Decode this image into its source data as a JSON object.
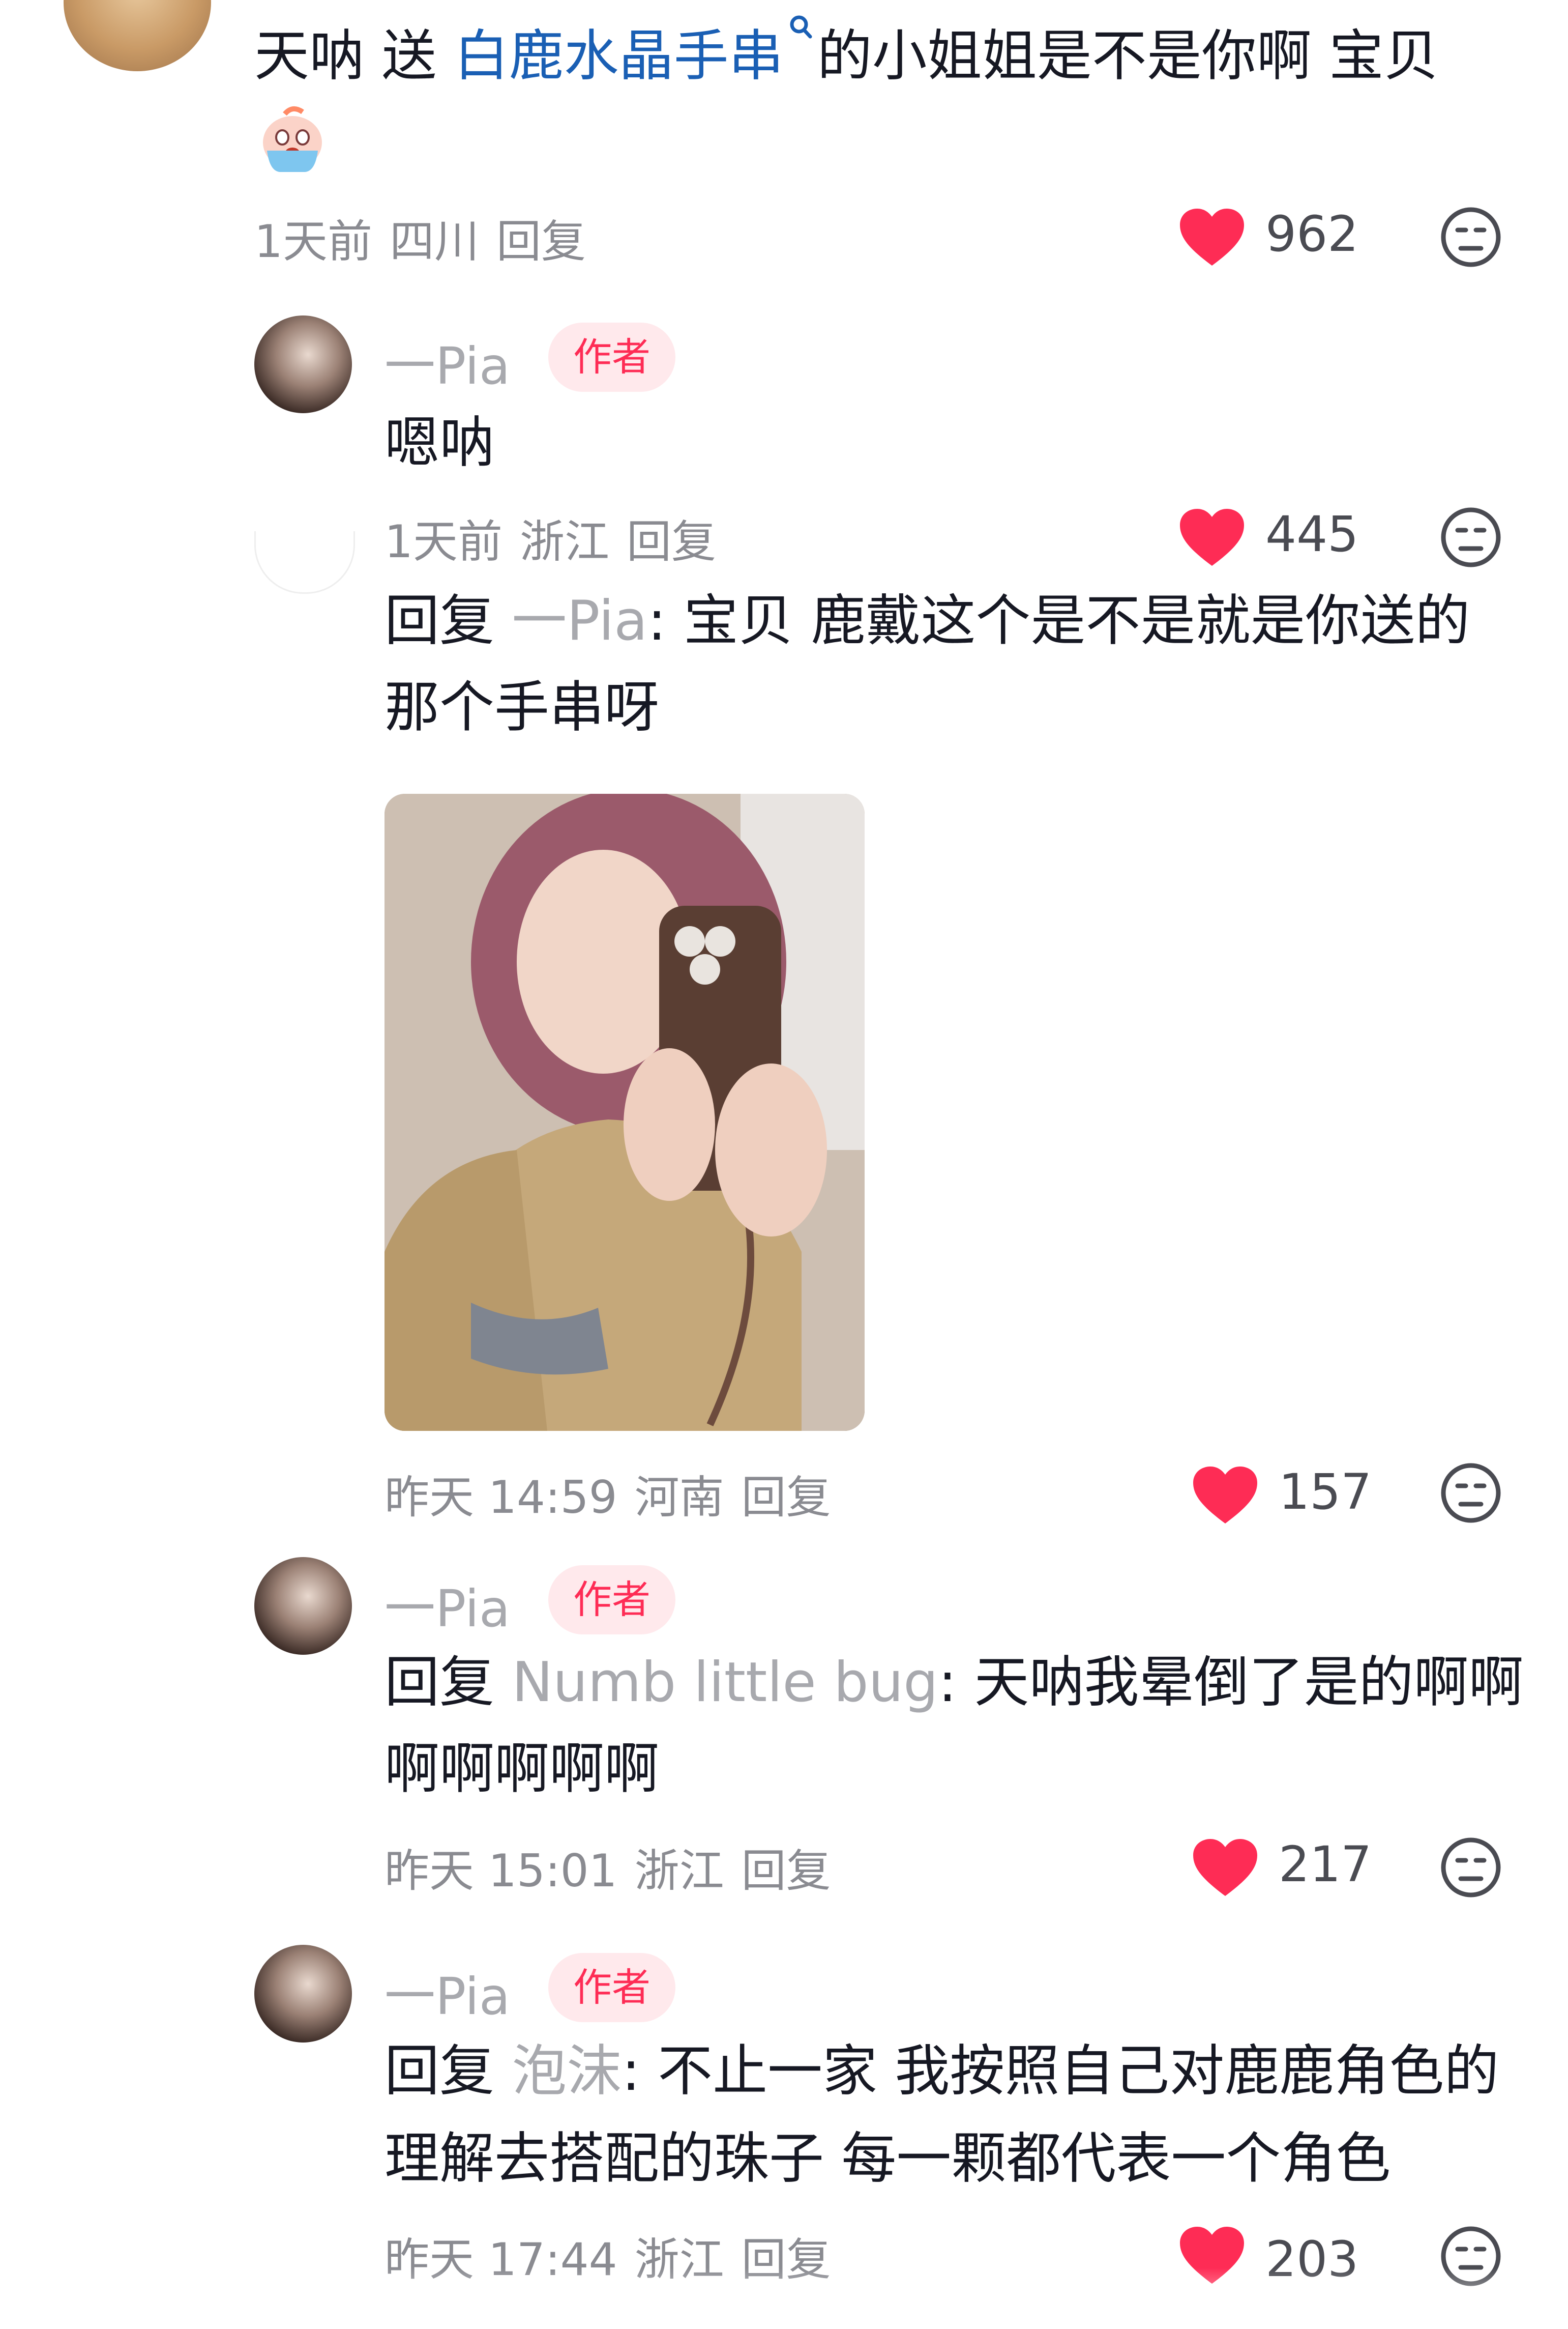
{
  "comments": [
    {
      "text_pre": "天呐 送 ",
      "link": "白鹿水晶手串",
      "text_post": "的小姐姐是不是你啊 宝贝",
      "emoji": "crying-face-emoji",
      "time": "1天前",
      "location": "四川",
      "reply_label": "回复",
      "likes": "962"
    }
  ],
  "replies": [
    {
      "name": "一Pia",
      "tag": "作者",
      "text": "嗯呐",
      "time": "1天前",
      "location": "浙江",
      "reply_label": "回复",
      "likes": "445"
    },
    {
      "reply_prefix": "回复",
      "reply_target": "一Pia",
      "line1": ": 宝贝 鹿戴这个是不是就是你送的",
      "line2": "那个手串呀",
      "time": "昨天 14:59",
      "location": "河南",
      "reply_label": "回复",
      "likes": "157"
    },
    {
      "name": "一Pia",
      "tag": "作者",
      "reply_prefix": "回复",
      "reply_target": "Numb little bug",
      "line1": ": 天呐我晕倒了是的啊啊",
      "line2": "啊啊啊啊啊",
      "time": "昨天 15:01",
      "location": "浙江",
      "reply_label": "回复",
      "likes": "217"
    },
    {
      "name": "一Pia",
      "tag": "作者",
      "reply_prefix": "回复",
      "reply_target": "泡沫",
      "line1": ": 不止一家 我按照自己对鹿鹿角色的",
      "line2": "理解去搭配的珠子 每一颗都代表一个角色",
      "time": "昨天 17:44",
      "location": "浙江",
      "reply_label": "回复",
      "likes": "203"
    }
  ],
  "icons": {
    "heart": "heart-icon",
    "emoji": "emoji-face-icon",
    "search": "search-icon"
  },
  "colors": {
    "heart": "#fe2c55",
    "link": "#1a5fb4",
    "author_tag_bg": "#ffe9ec"
  }
}
